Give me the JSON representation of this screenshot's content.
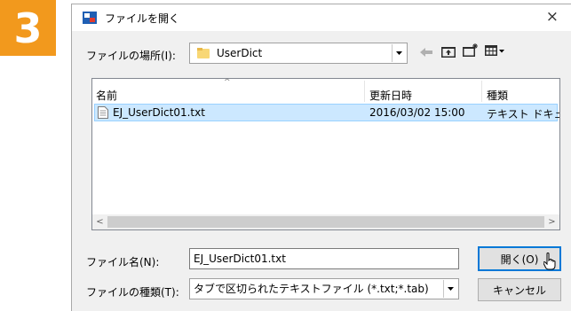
{
  "step": {
    "number": "3",
    "color": "#f2991d"
  },
  "dialog": {
    "title": "ファイルを開く",
    "close": "×",
    "location_label": "ファイルの場所(I):",
    "location_value": "UserDict",
    "columns": {
      "name": "名前",
      "modified": "更新日時",
      "type": "種類"
    },
    "files": [
      {
        "name": "EJ_UserDict01.txt",
        "modified": "2016/03/02 15:00",
        "type": "テキスト ドキュメン"
      }
    ],
    "filename_label": "ファイル名(N):",
    "filename_value": "EJ_UserDict01.txt",
    "filetype_label": "ファイルの種類(T):",
    "filetype_value": "タブで区切られたテキストファイル (*.txt;*.tab)",
    "open_button": "開く(O)",
    "cancel_button": "キャンセル",
    "icons": [
      "app-icon",
      "folder-icon",
      "back-icon",
      "up-folder-icon",
      "new-folder-icon",
      "view-menu-icon",
      "text-file-icon"
    ],
    "accent": "#0078d7",
    "selection": "#cce8ff"
  }
}
